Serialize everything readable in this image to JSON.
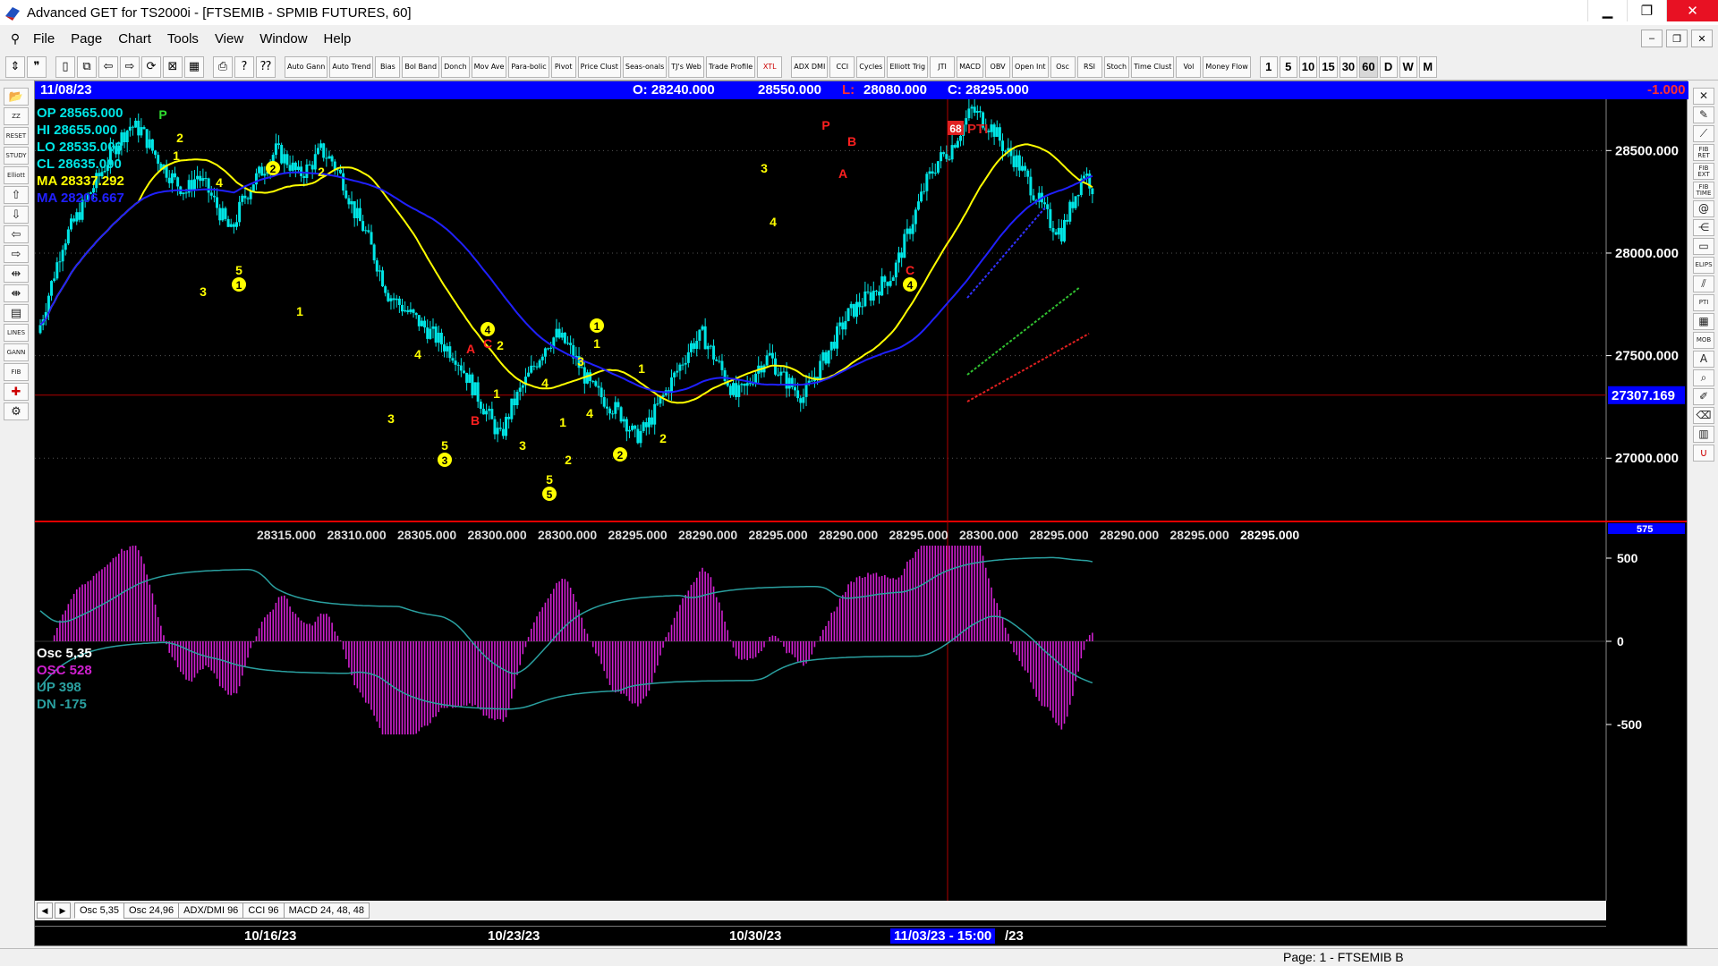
{
  "window": {
    "title": "Advanced GET for TS2000i - [FTSEMIB - SPMIB FUTURES, 60]",
    "minimize": "▁",
    "restore": "❐",
    "close": "✕"
  },
  "menu": {
    "items": [
      "File",
      "Page",
      "Chart",
      "Tools",
      "View",
      "Window",
      "Help"
    ],
    "mdi_buttons": [
      "‒",
      "❐",
      "✕"
    ]
  },
  "toolbar": {
    "study_buttons": [
      "Auto Gann",
      "Auto Trend",
      "Bias",
      "Bol Band",
      "Donch",
      "Mov Ave",
      "Para-bolic",
      "Pivot",
      "Price Clust",
      "Seas-onals",
      "TJ's Web",
      "Trade Profile",
      "XTL",
      "ADX DMI",
      "CCI",
      "Cycles",
      "Elliott Trig",
      "JTI",
      "MACD",
      "OBV",
      "Open Int",
      "Osc",
      "RSI",
      "Stoch",
      "Time Clust",
      "Vol",
      "Money Flow"
    ],
    "time_buttons": [
      "1",
      "5",
      "10",
      "15",
      "30",
      "60",
      "D",
      "W",
      "M"
    ]
  },
  "infobar": {
    "date": "11/08/23",
    "open": "O: 28240.000",
    "high": "28550.000",
    "low_label": "L:",
    "low": "28080.000",
    "close": "C: 28295.000",
    "change": "-1.000"
  },
  "legend": {
    "op": "OP  28565.000",
    "hi": "HI   28655.000",
    "lo": "LO  28535.000",
    "cl": "CL  28635.000",
    "ma1": "MA  28337.292",
    "ma2": "MA  28206.667"
  },
  "osc_legend": {
    "title": "Osc 5,35",
    "osc": "OSC 528",
    "up": "UP   398",
    "dn": "DN   -175"
  },
  "price_axis": {
    "labels": [
      "28500.000",
      "28000.000",
      "27500.000",
      "27000.000"
    ],
    "cursor_price": "27307.169"
  },
  "osc_axis": {
    "labels": [
      "500",
      "0",
      "-500"
    ],
    "top_clip": "575"
  },
  "pti": {
    "value": "68",
    "label": "PTI"
  },
  "bottom_price_labels": [
    "28315.000",
    "28310.000",
    "28305.000",
    "28300.000",
    "28300.000",
    "28295.000",
    "28290.000",
    "28295.000",
    "28290.000",
    "28295.000",
    "28300.000",
    "28295.000",
    "28290.000",
    "28295.000",
    "28295.000"
  ],
  "tabs": [
    "Osc 5,35",
    "Osc 24,96",
    "ADX/DMI 96",
    "CCI 96",
    "MACD 24, 48, 48"
  ],
  "dates": {
    "d1": "10/16/23",
    "d2": "10/23/23",
    "d3": "10/30/23",
    "cursor": "11/03/23 - 15:00",
    "after": "/23"
  },
  "wave_labels": {
    "P": "P",
    "one": "1",
    "two": "2",
    "three": "3",
    "four": "4",
    "five": "5",
    "A": "A",
    "B": "B",
    "C": "C",
    "circ1": "1",
    "circ2": "2",
    "circ3": "3",
    "circ4": "4",
    "circ5": "5"
  },
  "status": {
    "page": "Page: 1 - FTSEMIB B"
  },
  "colors": {
    "background": "#000000",
    "candle": "#00e5e5",
    "ma_yellow": "#ffff00",
    "ma_blue": "#2020ff",
    "wave_yellow": "#ffff00",
    "wave_red": "#ff2020",
    "osc": "#d020d0",
    "osc_band": "#2aa0a0",
    "cursor_line": "#b00000"
  },
  "chart_data": {
    "type": "candlestick",
    "symbol": "FTSEMIB - SPMIB FUTURES",
    "interval": "60",
    "ylim": [
      26700,
      28750
    ],
    "close_series": [
      27650,
      27850,
      28050,
      28150,
      28250,
      28350,
      28450,
      28550,
      28620,
      28600,
      28500,
      28420,
      28350,
      28300,
      28380,
      28300,
      28200,
      28100,
      28250,
      28350,
      28420,
      28500,
      28450,
      28380,
      28420,
      28500,
      28450,
      28350,
      28200,
      28100,
      27950,
      27800,
      27750,
      27700,
      27650,
      27600,
      27550,
      27500,
      27400,
      27300,
      27200,
      27100,
      27250,
      27350,
      27450,
      27550,
      27600,
      27550,
      27450,
      27350,
      27300,
      27250,
      27200,
      27100,
      27150,
      27250,
      27350,
      27450,
      27550,
      27600,
      27500,
      27400,
      27300,
      27350,
      27450,
      27500,
      27400,
      27350,
      27300,
      27400,
      27500,
      27600,
      27700,
      27750,
      27800,
      27850,
      27900,
      28050,
      28200,
      28350,
      28450,
      28500,
      28600,
      28700,
      28650,
      28600,
      28500,
      28450,
      28350,
      28250,
      28150,
      28100,
      28250,
      28400,
      28300
    ],
    "ma_yellow_end": 28337.292,
    "ma_blue_end": 28206.667
  }
}
